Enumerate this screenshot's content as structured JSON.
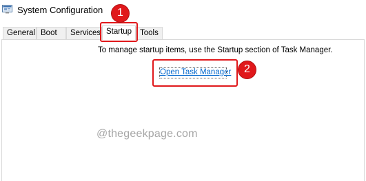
{
  "window": {
    "title": "System Configuration",
    "icon": "msconfig-icon"
  },
  "tabs": [
    {
      "label": "General",
      "active": false
    },
    {
      "label": "Boot",
      "active": false
    },
    {
      "label": "Services",
      "active": false
    },
    {
      "label": "Startup",
      "active": true
    },
    {
      "label": "Tools",
      "active": false
    }
  ],
  "startup": {
    "info_text": "To manage startup items, use the Startup section of Task Manager.",
    "link_label": "Open Task Manager"
  },
  "watermark": "@thegeekpage.com",
  "callouts": [
    {
      "number": "1"
    },
    {
      "number": "2"
    }
  ],
  "colors": {
    "callout": "#e0181b",
    "link": "#0066cc",
    "watermark": "#a6a6a6"
  }
}
